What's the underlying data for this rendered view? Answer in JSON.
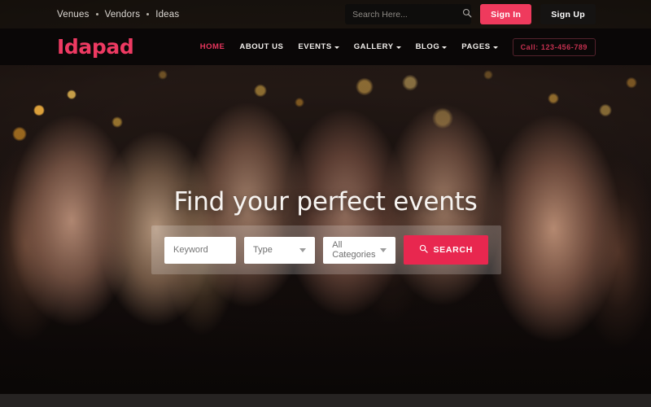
{
  "colors": {
    "accent_pink": "#ef3a5d",
    "accent_search": "#e8274f",
    "logo_pink": "#ee3a62",
    "nav_bar": "#0a0707",
    "call_text": "#c3304f"
  },
  "topbar": {
    "links": [
      {
        "label": "Venues"
      },
      {
        "label": "Vendors"
      },
      {
        "label": "Ideas"
      }
    ],
    "search": {
      "value": "",
      "placeholder": "Search Here...",
      "icon": "search-icon"
    },
    "sign_in_label": "Sign In",
    "sign_up_label": "Sign Up"
  },
  "navbar": {
    "logo": "Idapad",
    "items": [
      {
        "label": "HOME",
        "active": true,
        "caret": false
      },
      {
        "label": "ABOUT US",
        "active": false,
        "caret": false
      },
      {
        "label": "EVENTS",
        "active": false,
        "caret": true
      },
      {
        "label": "GALLERY",
        "active": false,
        "caret": true
      },
      {
        "label": "BLOG",
        "active": false,
        "caret": true
      },
      {
        "label": "PAGES",
        "active": false,
        "caret": true
      }
    ],
    "call_label": "Call: 123-456-789"
  },
  "hero": {
    "title": "Find your perfect events",
    "form": {
      "keyword": {
        "value": "",
        "placeholder": "Keyword"
      },
      "type": {
        "selected": "Type"
      },
      "category": {
        "selected": "All Categories"
      },
      "search_button_label": "SEARCH",
      "search_button_icon": "search-icon"
    }
  }
}
